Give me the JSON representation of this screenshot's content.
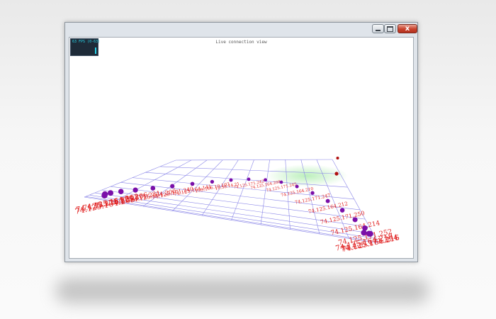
{
  "window": {
    "controls": {
      "minimize_icon": "minimize-icon",
      "maximize_icon": "maximize-icon",
      "close_icon": "close-icon",
      "close_glyph": "x"
    }
  },
  "overlay": {
    "fps_text": "63 FPS (0-63)"
  },
  "view": {
    "title": "Live connection view"
  },
  "colors": {
    "grid": "#8a86e8",
    "near_fill": "#b8efb8",
    "node": "#7a0fa8",
    "node_alert": "#b01010",
    "label": "#e02020",
    "fps_text": "#28d4e8",
    "fps_bg": "#1e2b38"
  },
  "connections": [
    {
      "ip": "74.125.164.203",
      "status": "active"
    },
    {
      "ip": "74.125.171.231",
      "status": "active"
    },
    {
      "ip": "74.125.164.203",
      "status": "active"
    },
    {
      "ip": "74.125.171.206",
      "status": "active"
    },
    {
      "ip": "74.125.171.231",
      "status": "active"
    },
    {
      "ip": "74.125.164.206",
      "status": "active"
    },
    {
      "ip": "74.125.171.240",
      "status": "active"
    },
    {
      "ip": "74.125.164.141",
      "status": "active"
    },
    {
      "ip": "199.166.10.103",
      "status": "active"
    },
    {
      "ip": "10.58.14.21",
      "status": "active"
    },
    {
      "ip": "74.125.171.242",
      "status": "active"
    },
    {
      "ip": "74.125.164.208",
      "status": "active"
    },
    {
      "ip": "74.125.171.245",
      "status": "active"
    },
    {
      "ip": "74.125.164.210",
      "status": "active"
    },
    {
      "ip": "74.125.171.247",
      "status": "active"
    },
    {
      "ip": "74.125.164.212",
      "status": "active"
    },
    {
      "ip": "74.125.171.250",
      "status": "active"
    },
    {
      "ip": "74.125.164.214",
      "status": "active"
    },
    {
      "ip": "74.125.171.252",
      "status": "active"
    },
    {
      "ip": "74.125.164.216",
      "status": "active"
    },
    {
      "ip": "74.125.171.254",
      "status": "active"
    },
    {
      "ip": "74.125.164.218",
      "status": "active"
    },
    {
      "ip": "192.168.1.12",
      "status": "alert"
    },
    {
      "ip": "192.168.1.13",
      "status": "alert"
    }
  ]
}
